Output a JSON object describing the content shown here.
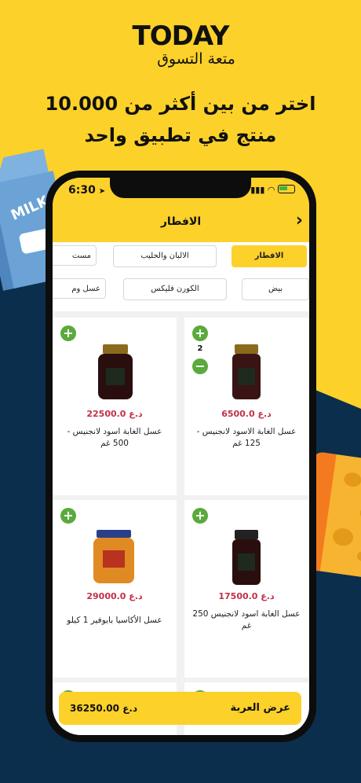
{
  "brand": {
    "logo": "TODAY",
    "tagline": "متعة التسوق"
  },
  "headline": {
    "line1": "اختر من بين أكثر من 10.000",
    "line2": "منتج في تطبيق واحد"
  },
  "decor": {
    "milk_label": "MILK"
  },
  "status_bar": {
    "time": "6:30"
  },
  "nav": {
    "title": "الافطار",
    "back_icon": "chevron-right-icon"
  },
  "categories_row1": [
    {
      "label": "الافطار",
      "active": true
    },
    {
      "label": "الالبان والحليب",
      "active": false
    },
    {
      "label": "مست",
      "active": false
    }
  ],
  "categories_row2": [
    {
      "label": "بيض"
    },
    {
      "label": "الكورن فليكس"
    },
    {
      "label": "عسل وم"
    }
  ],
  "products": [
    {
      "name": "عسل الغابة الاسود لانجنيس - 125 غم",
      "price": "6500.0 د.ع",
      "quantity": "2"
    },
    {
      "name": "عسل الغابة اسود لانجنيس - 500 غم",
      "price": "22500.0 د.ع"
    },
    {
      "name": "عسل الغابة اسود لانجنيس 250 غم",
      "price": "17500.0 د.ع"
    },
    {
      "name": "عسل الأكاسيا بايوفير 1 كيلو",
      "price": "29000.0 د.ع"
    }
  ],
  "cart": {
    "label": "عرض العربة",
    "total": "36250.00 د.ع"
  },
  "colors": {
    "brand_yellow": "#fcd12a",
    "navy": "#0b2e4c",
    "price_red": "#c0304a",
    "add_green": "#5aaa3c"
  }
}
